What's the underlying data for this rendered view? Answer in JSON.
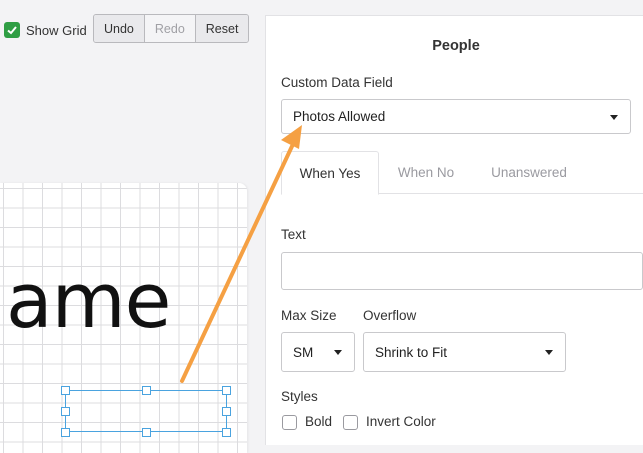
{
  "toolbar": {
    "show_grid_label": "Show Grid",
    "undo_label": "Undo",
    "redo_label": "Redo",
    "reset_label": "Reset"
  },
  "canvas": {
    "text": "ame"
  },
  "panel": {
    "title": "People",
    "custom_field_label": "Custom Data Field",
    "custom_field_value": "Photos Allowed",
    "tabs": [
      {
        "label": "When Yes"
      },
      {
        "label": "When No"
      },
      {
        "label": "Unanswered"
      }
    ],
    "text_label": "Text",
    "text_value": "",
    "max_size_label": "Max Size",
    "max_size_value": "SM",
    "overflow_label": "Overflow",
    "overflow_value": "Shrink to Fit",
    "styles_label": "Styles",
    "bold_label": "Bold",
    "invert_label": "Invert Color"
  },
  "colors": {
    "accent_green": "#2f9e44",
    "selection_blue": "#4aa3df",
    "arrow_orange": "#f5a043"
  }
}
